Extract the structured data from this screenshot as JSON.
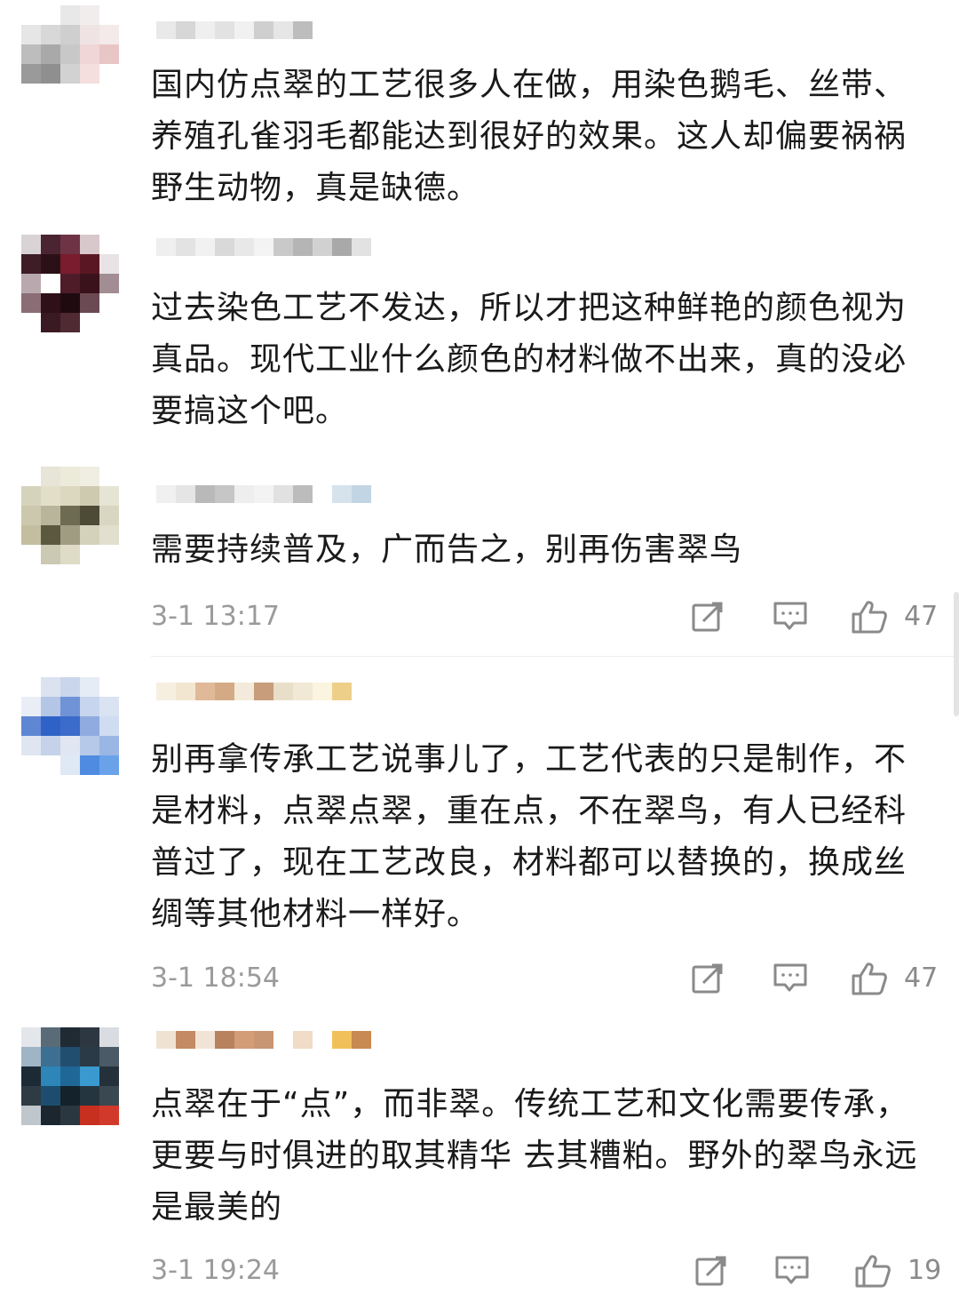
{
  "comments": [
    {
      "text": "国内仿点翠的工艺很多人在做，用染色鹅毛、丝带、养殖孔雀羽毛都能达到很好的效果。这人却偏要祸祸野生动物，真是缺德。"
    },
    {
      "text": "过去染色工艺不发达，所以才把这种鲜艳的颜色视为真品。现代工业什么颜色的材料做不出来，真的没必要搞这个吧。"
    },
    {
      "text": "需要持续普及，广而告之，别再伤害翠鸟",
      "time": "3-1 13:17",
      "likes": "47"
    },
    {
      "text": "别再拿传承工艺说事儿了，工艺代表的只是制作，不是材料，点翠点翠，重在点，不在翠鸟，有人已经科普过了，现在工艺改良，材料都可以替换的，换成丝绸等其他材料一样好。",
      "time": "3-1 18:54",
      "likes": "47"
    },
    {
      "text": "点翠在于“点”，而非翠。传统工艺和文化需要传承，更要与时俱进的取其精华 去其糟粕。野外的翠鸟永远是最美的",
      "time": "3-1 19:24",
      "likes": "19"
    }
  ],
  "icons": {
    "share": "share-icon",
    "comment": "comment-icon",
    "like": "thumbs-up-icon"
  },
  "colors": {
    "text": "#1a1a1a",
    "meta": "#9a9a9a",
    "icon": "#8a8a8a"
  }
}
